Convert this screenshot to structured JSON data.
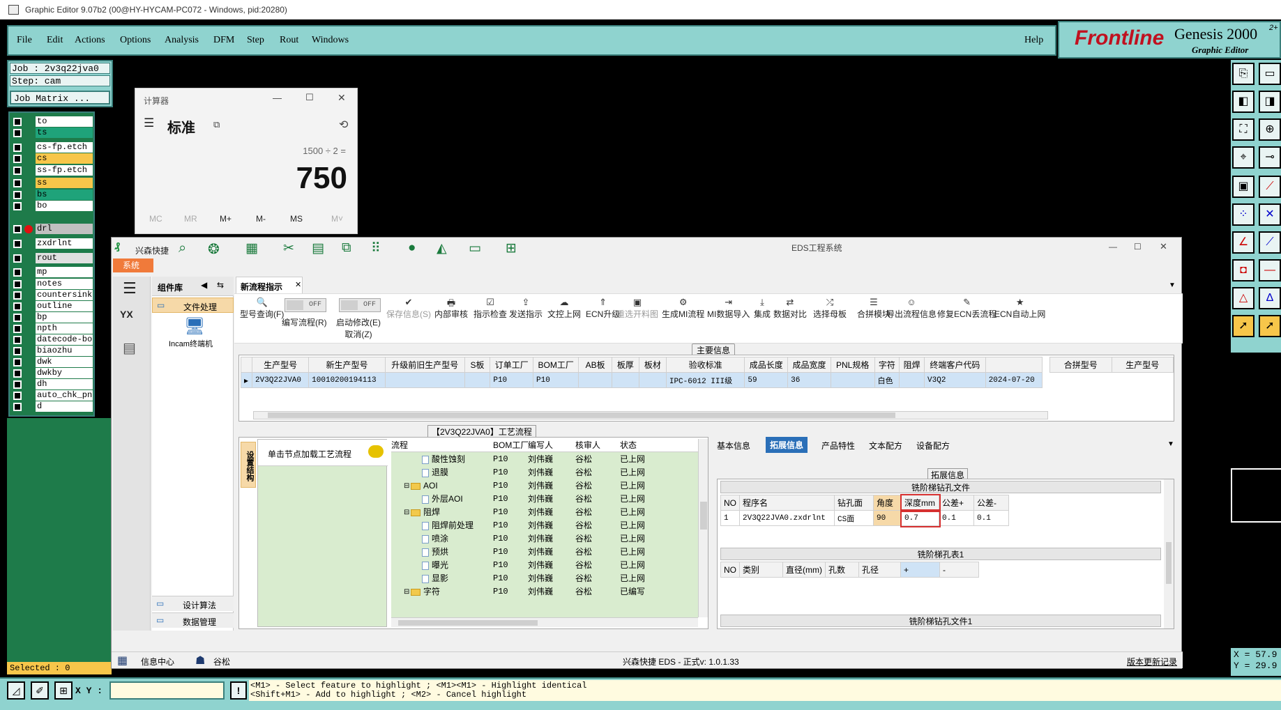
{
  "window": {
    "title": "Graphic Editor 9.07b2 (00@HY-HYCAM-PC072 - Windows, pid:20280)"
  },
  "menu": {
    "items": [
      "File",
      "Edit",
      "Actions",
      "Options",
      "Analysis",
      "DFM",
      "Step",
      "Rout",
      "Windows"
    ],
    "help": "Help"
  },
  "brand": {
    "logo": "Frontline",
    "product": "Genesis 2000",
    "sup": "2+",
    "sub": "Graphic Editor"
  },
  "job": {
    "job": "Job : 2v3q22jva0",
    "step": "Step: cam",
    "matrix": "Job Matrix ..."
  },
  "layers": [
    {
      "name": "to",
      "color": "#ffffff"
    },
    {
      "name": "ts",
      "color": "#1fa37a"
    },
    {
      "name": "cs-fp.etch",
      "color": "#ffffff"
    },
    {
      "name": "cs",
      "color": "#f7c64a"
    },
    {
      "name": "ss-fp.etch",
      "color": "#ffffff"
    },
    {
      "name": "ss",
      "color": "#f7c64a"
    },
    {
      "name": "bs",
      "color": "#1fa37a"
    },
    {
      "name": "bo",
      "color": "#ffffff"
    },
    {
      "name": "drl",
      "color": "#c0c0c0"
    },
    {
      "name": "zxdrlnt",
      "color": "#ffffff"
    },
    {
      "name": "rout",
      "color": "#e0e0e0"
    },
    {
      "name": "mp",
      "color": "#ffffff"
    },
    {
      "name": "notes",
      "color": "#ffffff"
    },
    {
      "name": "countersink",
      "color": "#ffffff"
    },
    {
      "name": "outline",
      "color": "#ffffff"
    },
    {
      "name": "bp",
      "color": "#ffffff"
    },
    {
      "name": "npth",
      "color": "#ffffff"
    },
    {
      "name": "datecode-bo",
      "color": "#ffffff"
    },
    {
      "name": "biaozhu",
      "color": "#ffffff"
    },
    {
      "name": "dwk",
      "color": "#ffffff"
    },
    {
      "name": "dwkby",
      "color": "#ffffff"
    },
    {
      "name": "dh",
      "color": "#ffffff"
    },
    {
      "name": "auto_chk_pn",
      "color": "#ffffff"
    },
    {
      "name": "d",
      "color": "#ffffff"
    }
  ],
  "selected": "Selected : 0",
  "bottom": {
    "xy_label": "X Y :",
    "hint1": "<M1> - Select feature to highlight ; <M1><M1> - Highlight identical",
    "hint2": "<Shift+M1> - Add to highlight ; <M2> - Cancel highlight"
  },
  "coords": {
    "x": "X = 57.9",
    "y": "Y = 29.9"
  },
  "calculator": {
    "title": "计算器",
    "mode": "标准",
    "expression": "1500 ÷ 2 =",
    "result": "750",
    "memory": [
      "MC",
      "MR",
      "M+",
      "M-",
      "MS",
      "M˅"
    ]
  },
  "eds": {
    "title": "EDS工程系统",
    "quick": "兴森快捷",
    "system_tab": "系统",
    "sidebar_title": "组件库",
    "file_proc": "文件处理",
    "incam": "Incam终端机",
    "design_algo": "设计算法",
    "data_mgmt": "数据管理",
    "doc_tab": "新流程指示",
    "toolbar": [
      {
        "label": "型号查询(F)",
        "icon": "🔍",
        "dis": false
      },
      {
        "label": "编写流程(R)",
        "icon": "",
        "dis": false
      },
      {
        "label": "启动修改(E)",
        "sub": "取消(Z)",
        "icon": "",
        "dis": false
      },
      {
        "label": "保存信息(S)",
        "icon": "✔",
        "dis": true
      },
      {
        "label": "内部审核",
        "icon": "🖶",
        "dis": false
      },
      {
        "label": "指示检查",
        "icon": "☑",
        "dis": false
      },
      {
        "label": "发送指示",
        "icon": "⇪",
        "dis": false
      },
      {
        "label": "文控上网",
        "icon": "☁",
        "dis": false
      },
      {
        "label": "ECN升级",
        "icon": "⇑",
        "dis": false
      },
      {
        "label": "重选开料图",
        "icon": "▣",
        "dis": true
      },
      {
        "label": "生成MI流程",
        "icon": "⚙",
        "dis": false
      },
      {
        "label": "MI数据导入",
        "icon": "⇥",
        "dis": false
      },
      {
        "label": "集成",
        "icon": "⤓",
        "dis": false
      },
      {
        "label": "数据对比",
        "icon": "⇄",
        "dis": false
      },
      {
        "label": "选择母板",
        "icon": "⤮",
        "dis": false
      },
      {
        "label": "合拼模块",
        "icon": "☰",
        "dis": false
      },
      {
        "label": "导出流程信息",
        "icon": "☺",
        "dis": false
      },
      {
        "label": "修复ECN丢流程",
        "icon": "✎",
        "dis": false
      },
      {
        "label": "ECN自动上网",
        "icon": "★",
        "dis": false
      }
    ],
    "toggle_off": "OFF",
    "main_info": "主要信息",
    "main_headers": [
      "生产型号",
      "新生产型号",
      "升级前旧生产型号",
      "S板",
      "订单工厂",
      "BOM工厂",
      "AB板",
      "板厚",
      "板材",
      "验收标准",
      "成品长度",
      "成品宽度",
      "PNL规格",
      "字符",
      "阻焊",
      "终端客户代码",
      ""
    ],
    "main_row": [
      "2V3Q22JVA0",
      "10010200194113",
      "",
      "",
      "P10",
      "P10",
      "",
      "",
      "",
      "IPC-6012 III级",
      "59",
      "36",
      "",
      "白色",
      "",
      "V3Q2",
      "2024-07-20"
    ],
    "merge_headers": [
      "合拼型号",
      "生产型号"
    ],
    "process_title": "【2V3Q22JVA0】工艺流程",
    "vertical_tab": "设置结构",
    "load_hint": "单击节点加载工艺流程",
    "process_headers": [
      "流程",
      "BOM工厂",
      "编写人",
      "核审人",
      "状态"
    ],
    "process_rows": [
      {
        "name": "酸性蚀刻",
        "level": 2,
        "type": "doc",
        "f": "P10",
        "w": "刘伟巍",
        "r": "谷松",
        "s": "已上网"
      },
      {
        "name": "退膜",
        "level": 2,
        "type": "doc",
        "f": "P10",
        "w": "刘伟巍",
        "r": "谷松",
        "s": "已上网"
      },
      {
        "name": "AOI",
        "level": 1,
        "type": "folder",
        "f": "P10",
        "w": "刘伟巍",
        "r": "谷松",
        "s": "已上网"
      },
      {
        "name": "外层AOI",
        "level": 2,
        "type": "doc",
        "f": "P10",
        "w": "刘伟巍",
        "r": "谷松",
        "s": "已上网"
      },
      {
        "name": "阻焊",
        "level": 1,
        "type": "folder",
        "f": "P10",
        "w": "刘伟巍",
        "r": "谷松",
        "s": "已上网"
      },
      {
        "name": "阻焊前处理",
        "level": 2,
        "type": "doc",
        "f": "P10",
        "w": "刘伟巍",
        "r": "谷松",
        "s": "已上网"
      },
      {
        "name": "喷涂",
        "level": 2,
        "type": "doc",
        "f": "P10",
        "w": "刘伟巍",
        "r": "谷松",
        "s": "已上网"
      },
      {
        "name": "预烘",
        "level": 2,
        "type": "doc",
        "f": "P10",
        "w": "刘伟巍",
        "r": "谷松",
        "s": "已上网"
      },
      {
        "name": "曝光",
        "level": 2,
        "type": "doc",
        "f": "P10",
        "w": "刘伟巍",
        "r": "谷松",
        "s": "已上网"
      },
      {
        "name": "显影",
        "level": 2,
        "type": "doc",
        "f": "P10",
        "w": "刘伟巍",
        "r": "谷松",
        "s": "已上网"
      },
      {
        "name": "字符",
        "level": 1,
        "type": "folder",
        "f": "P10",
        "w": "刘伟巍",
        "r": "谷松",
        "s": "已编写"
      }
    ],
    "right_tabs": [
      "基本信息",
      "拓展信息",
      "产品特性",
      "文本配方",
      "设备配方"
    ],
    "ext_title": "拓展信息",
    "mill_file": "铣阶梯钻孔文件",
    "mill_headers": [
      "NO",
      "程序名",
      "钻孔面",
      "角度",
      "深度mm",
      "公差+",
      "公差-"
    ],
    "mill_row": [
      "1",
      "2V3Q22JVA0.zxdrlnt",
      "CS面",
      "90",
      "0.7",
      "0.1",
      "0.1"
    ],
    "step_table_title": "铣阶梯孔表1",
    "step_headers": [
      "NO",
      "类别",
      "直径(mm)",
      "孔数",
      "孔径",
      "+",
      "-"
    ],
    "mill_file2": "铣阶梯钻孔文件1",
    "status_info": "信息中心",
    "status_user": "谷松",
    "status_center": "兴森快捷 EDS - 正式v: 1.0.1.33",
    "status_link": "版本更新记录"
  }
}
